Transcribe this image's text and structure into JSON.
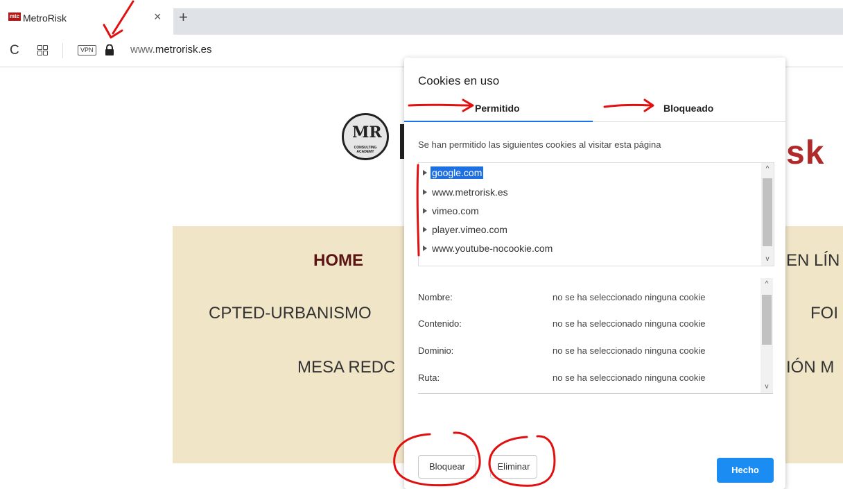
{
  "browser": {
    "tab_title": "MetroRisk",
    "tab_favicon_text": "mtc",
    "close_glyph": "×",
    "newtab_glyph": "+",
    "reload_glyph": "C",
    "vpn_label": "VPN",
    "url_prefix": "www.",
    "url_domain": "metrorisk.es"
  },
  "site": {
    "logo_letters": "MR",
    "logo_caption": "CONSULTING ACADEMY",
    "brand_fragment": "sk",
    "nav": {
      "home": "HOME",
      "cpted": "CPTED-URBANISMO",
      "mesa": "MESA REDC",
      "enlin": "EN LÍN",
      "for": "FOI",
      "ion": "IÓN M"
    }
  },
  "dialog": {
    "title": "Cookies en uso",
    "tabs": [
      "Permitido",
      "Bloqueado"
    ],
    "active_tab": "Permitido",
    "description": "Se han permitido las siguientes cookies al visitar esta página",
    "cookie_domains": [
      "google.com",
      "www.metrorisk.es",
      "vimeo.com",
      "player.vimeo.com",
      "www.youtube-nocookie.com"
    ],
    "selected_domain": "google.com",
    "details": [
      {
        "label": "Nombre:",
        "value": "no se ha seleccionado ninguna cookie"
      },
      {
        "label": "Contenido:",
        "value": "no se ha seleccionado ninguna cookie"
      },
      {
        "label": "Dominio:",
        "value": "no se ha seleccionado ninguna cookie"
      },
      {
        "label": "Ruta:",
        "value": "no se ha seleccionado ninguna cookie"
      }
    ],
    "buttons": {
      "block": "Bloquear",
      "delete": "Eliminar",
      "done": "Hecho"
    },
    "scroll_up": "^",
    "scroll_down": "v"
  },
  "colors": {
    "accent": "#1a73e8",
    "done_button": "#1a8cf2",
    "selection": "#1e6fe0",
    "annotation": "#e01010",
    "nav_background": "#f1e5c8",
    "brand": "#b02a2a"
  }
}
